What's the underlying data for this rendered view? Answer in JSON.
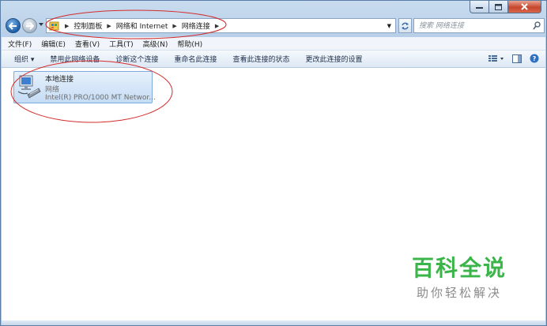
{
  "colors": {
    "window_frame": "#b7cfe8",
    "selection_fill": "#c5dcf5",
    "selection_border": "#7eabdc",
    "annotation_red": "#d42b2b",
    "watermark_green": "#3bb54a"
  },
  "titlebar": {
    "buttons": [
      "minimize-icon",
      "maximize-icon",
      "close-icon"
    ]
  },
  "address": {
    "crumbs": [
      {
        "label": "控制面板"
      },
      {
        "label": "网络和 Internet"
      },
      {
        "label": "网络连接"
      }
    ],
    "location_icon": "control-panel-icon"
  },
  "search": {
    "placeholder": "搜索 网络连接"
  },
  "menu": {
    "items": [
      "文件(F)",
      "编辑(E)",
      "查看(V)",
      "工具(T)",
      "高级(N)",
      "帮助(H)"
    ]
  },
  "command_bar": {
    "organize": "组织 ▾",
    "items": [
      "禁用此网络设备",
      "诊断这个连接",
      "重命名此连接",
      "查看此连接的状态",
      "更改此连接的设置"
    ],
    "right_icons": [
      "change-view-icon",
      "preview-pane-icon",
      "help-icon"
    ]
  },
  "connection": {
    "name": "本地连接",
    "type": "网络",
    "device": "Intel(R) PRO/1000 MT Networ...",
    "icon": "network-adapter-icon"
  },
  "watermark": {
    "title": "百科全说",
    "subtitle": "助你轻松解决"
  }
}
